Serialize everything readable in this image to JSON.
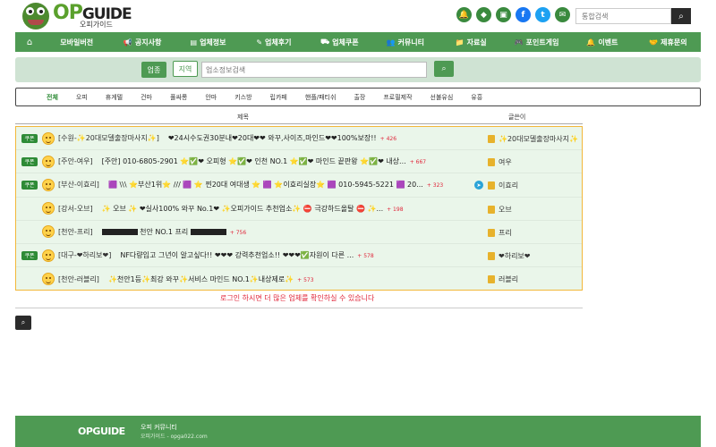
{
  "brand": {
    "op": "OP",
    "guide": "GUIDE",
    "sub": "오피가이드"
  },
  "header_search": {
    "placeholder": "통합검색",
    "icon": "search-icon"
  },
  "social": [
    "bell-icon",
    "tag-icon",
    "shop-icon",
    "facebook-icon",
    "twitter-icon",
    "mail-icon"
  ],
  "nav": {
    "home_icon": "home-icon",
    "items": [
      {
        "label": "모바일버전",
        "icon": ""
      },
      {
        "label": "공지사항",
        "icon": "megaphone-icon"
      },
      {
        "label": "업체정보",
        "icon": "list-icon"
      },
      {
        "label": "업체후기",
        "icon": "pen-icon"
      },
      {
        "label": "업체쿠폰",
        "icon": "car-icon"
      },
      {
        "label": "커뮤니티",
        "icon": "users-icon"
      },
      {
        "label": "자료실",
        "icon": "folder-icon"
      },
      {
        "label": "포인트게임",
        "icon": "gamepad-icon"
      },
      {
        "label": "이벤트",
        "icon": "bell-icon"
      },
      {
        "label": "제휴문의",
        "icon": "handshake-icon"
      }
    ]
  },
  "search_panel": {
    "category": "업종",
    "region": "지역",
    "placeholder": "업소정보검색"
  },
  "categories": [
    "전체",
    "오피",
    "휴게텔",
    "건마",
    "풀싸롱",
    "안마",
    "키스방",
    "립카페",
    "핸플/패티쉬",
    "출장",
    "프로필제작",
    "선불유심",
    "유흥"
  ],
  "list": {
    "header_title": "제목",
    "header_writer": "글쓴이",
    "rows": [
      {
        "coupon": "쿠폰",
        "subject": "[수원-✨20대모델출장마사지✨]",
        "body": "❤24시수도권30분내❤20대❤❤ 와꾸,사이즈,마인드❤❤100%보장!!",
        "count": "+ 426",
        "telegram": false,
        "writer": "✨20대모델출장마사지✨"
      },
      {
        "coupon": "쿠폰",
        "subject": "[주안-여우]",
        "body": "[주안] 010-6805-2901 ⭐✅❤ 오피형 ⭐✅❤ 인천 NO.1 ⭐✅❤ 마인드 끝판왕 ⭐✅❤ 내상...",
        "count": "+ 667",
        "telegram": false,
        "writer": "여우"
      },
      {
        "coupon": "쿠폰",
        "subject": "[부산-이효리]",
        "body": "🟪 \\\\\\ ⭐부산1위⭐ /// 🟪 ⭐ 찐20대 여대생 ⭐ 🟪 ⭐이효리실장⭐ 🟪 010-5945-5221 🟪 20...",
        "count": "+ 323",
        "telegram": true,
        "writer": "이효리"
      },
      {
        "coupon": "",
        "subject": "[강서-오브]",
        "body": "✨ 오브 ✨ ❤실사100% 와꾸 No.1❤ ✨오피가이드 추천업소✨ ⛔ 극강하드올탈 ⛔ ✨...",
        "count": "+ 198",
        "telegram": false,
        "writer": "오브"
      },
      {
        "coupon": "",
        "subject": "[천안-프리]",
        "body": "천안 NO.1 프리",
        "count": "+ 756",
        "telegram": false,
        "writer": "프리"
      },
      {
        "coupon": "쿠폰",
        "subject": "[대구-❤하리보❤]",
        "body": "NF다량입고 그년이 알고싶다!! ❤❤❤ 강력추천업소!! ❤❤❤✅자원이 다른 ...",
        "count": "+ 578",
        "telegram": false,
        "writer": "❤하리보❤"
      },
      {
        "coupon": "",
        "subject": "[천안-러블리]",
        "body": "✨천안1등✨최강 와꾸✨서비스 마인드 NO.1✨내상제로✨",
        "count": "+ 573",
        "telegram": false,
        "writer": "러블리"
      }
    ]
  },
  "login_message": "로그인 하시면 더 많은 업체를 확인하실 수 있습니다",
  "footer": {
    "logo": "OPGUIDE",
    "title": "오피 커뮤니티",
    "sub": "오피가이드 - opga022.com"
  },
  "colors": {
    "brand_green": "#4e9a53",
    "list_bg": "#eaf6ea",
    "list_border": "#f2b73a",
    "alert_red": "#e0263a"
  }
}
